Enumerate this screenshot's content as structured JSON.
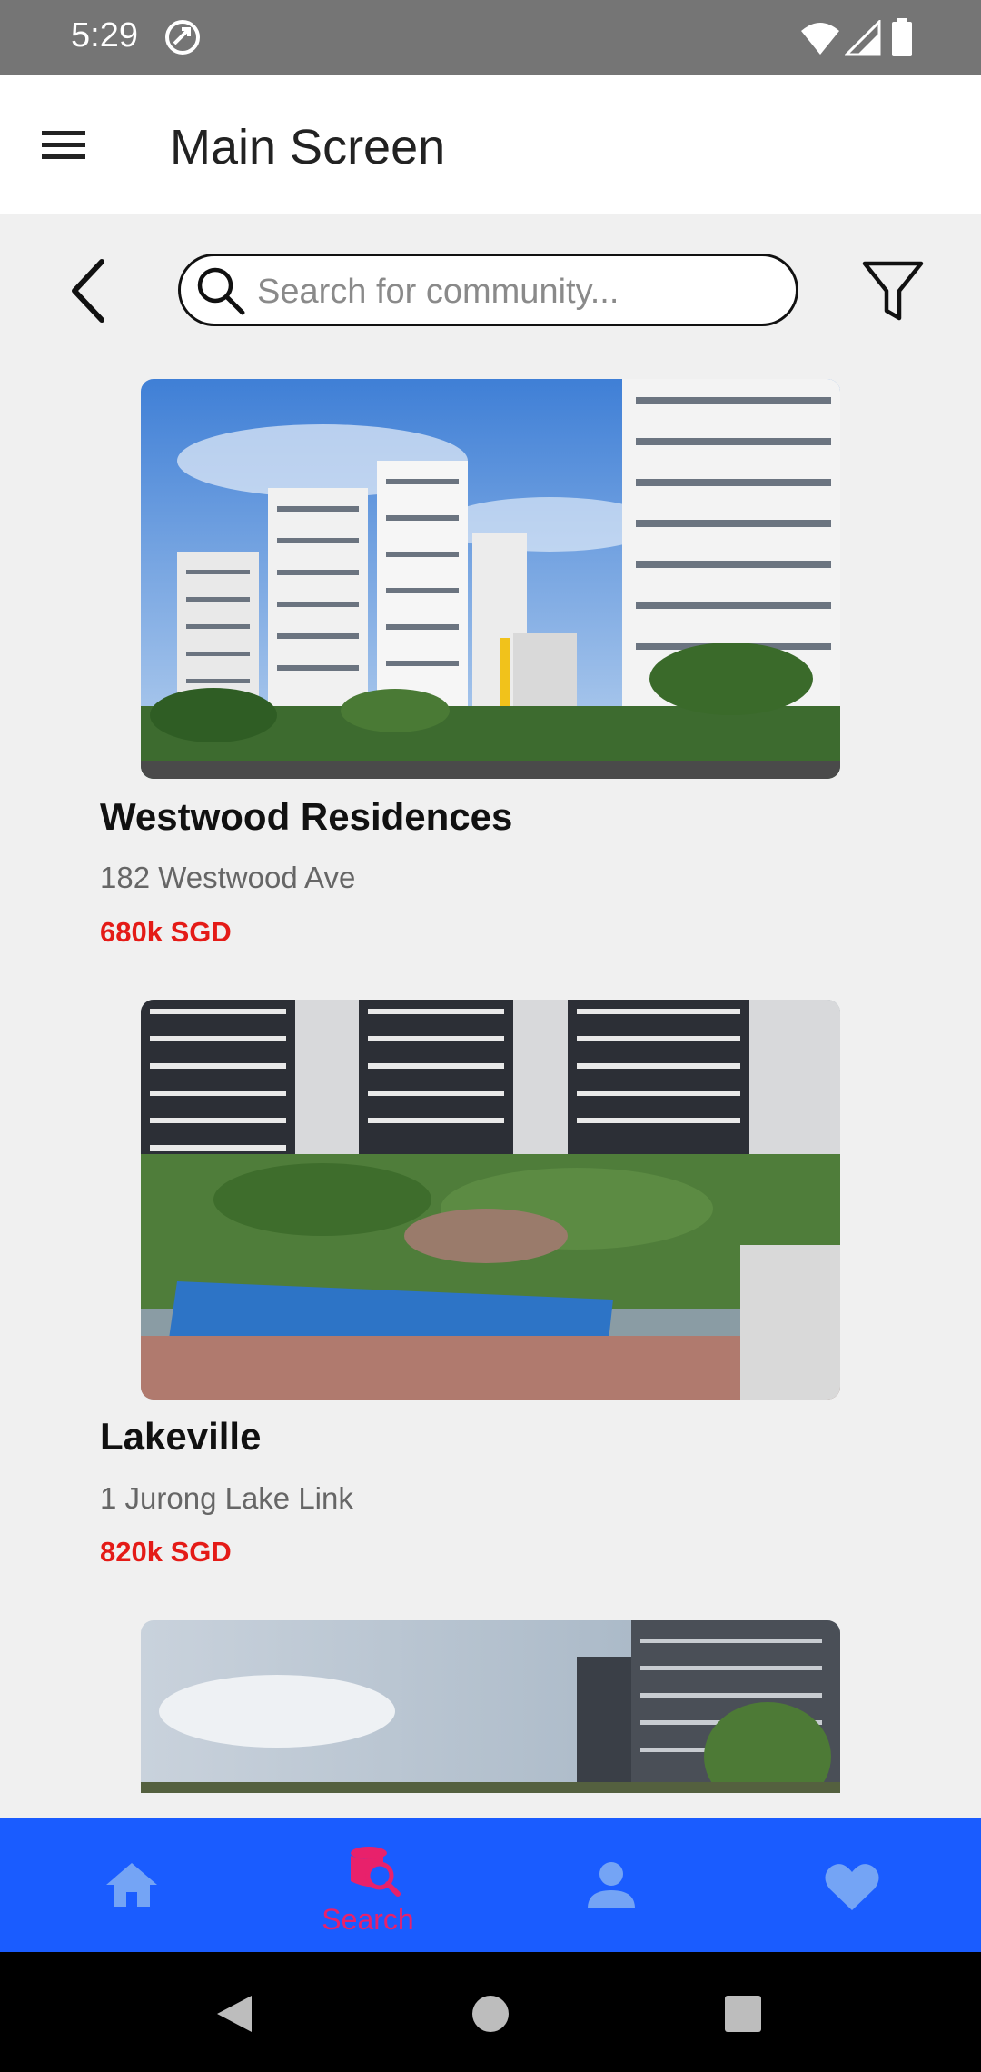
{
  "status_bar": {
    "time": "5:29"
  },
  "app_bar": {
    "title": "Main Screen"
  },
  "search": {
    "placeholder": "Search for community...",
    "value": ""
  },
  "listings": [
    {
      "name": "Westwood Residences",
      "address": "182 Westwood Ave",
      "price": "680k SGD"
    },
    {
      "name": "Lakeville",
      "address": "1 Jurong Lake Link",
      "price": "820k SGD"
    },
    {
      "name": "",
      "address": "",
      "price": ""
    }
  ],
  "bottom_nav": {
    "items": [
      {
        "icon": "home-icon",
        "label": ""
      },
      {
        "icon": "search-database-icon",
        "label": "Search",
        "active": true
      },
      {
        "icon": "person-icon",
        "label": ""
      },
      {
        "icon": "heart-icon",
        "label": ""
      }
    ]
  },
  "colors": {
    "accent": "#1a5cff",
    "active": "#e8216b",
    "price": "#e41b17",
    "status_bar": "#757575"
  }
}
